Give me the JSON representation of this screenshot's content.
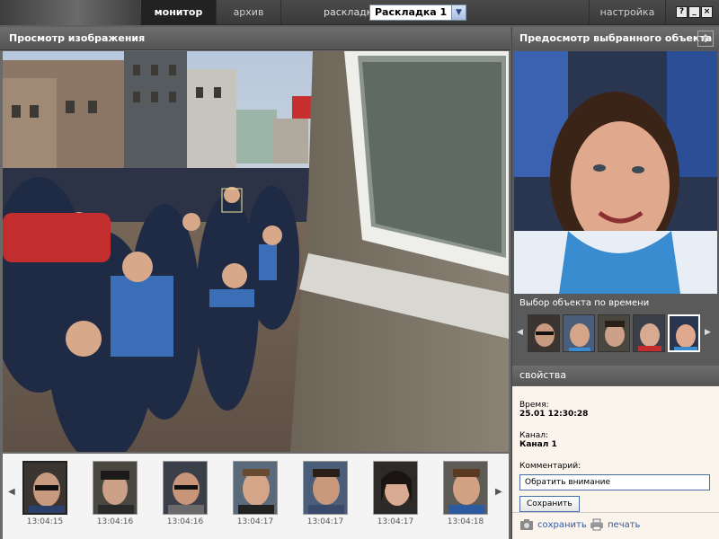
{
  "topbar": {
    "tabs": {
      "monitor": "монитор",
      "archive": "архив"
    },
    "layout_label": "раскладка",
    "layout_value": "Раскладка 1",
    "settings_label": "настройка",
    "help": "?",
    "minimize": "_",
    "close": "×"
  },
  "left_panel": {
    "title": "Просмотр изображения",
    "thumbnails": [
      {
        "time": "13:04:15"
      },
      {
        "time": "13:04:16"
      },
      {
        "time": "13:04:16"
      },
      {
        "time": "13:04:17"
      },
      {
        "time": "13:04:17"
      },
      {
        "time": "13:04:17"
      },
      {
        "time": "13:04:18"
      }
    ]
  },
  "right_panel": {
    "preview_title": "Предосмотр выбранного объекта",
    "time_select_label": "Выбор объекта по времени",
    "props_title": "свойства",
    "time_label": "Время:",
    "time_value": "25.01 12:30:28",
    "channel_label": "Канал:",
    "channel_value": "Канал 1",
    "comment_label": "Комментарий:",
    "comment_value": "Обратить внимание",
    "save_button": "Сохранить",
    "footer_save": "сохранить",
    "footer_print": "печать"
  },
  "colors": {
    "accent_link": "#2f5aa8",
    "active_tab": "#222222",
    "props_bg": "#fbf4ec"
  },
  "icons": [
    "camera-icon",
    "printer-icon",
    "expand-icon",
    "chevron-left-icon",
    "chevron-right-icon"
  ]
}
